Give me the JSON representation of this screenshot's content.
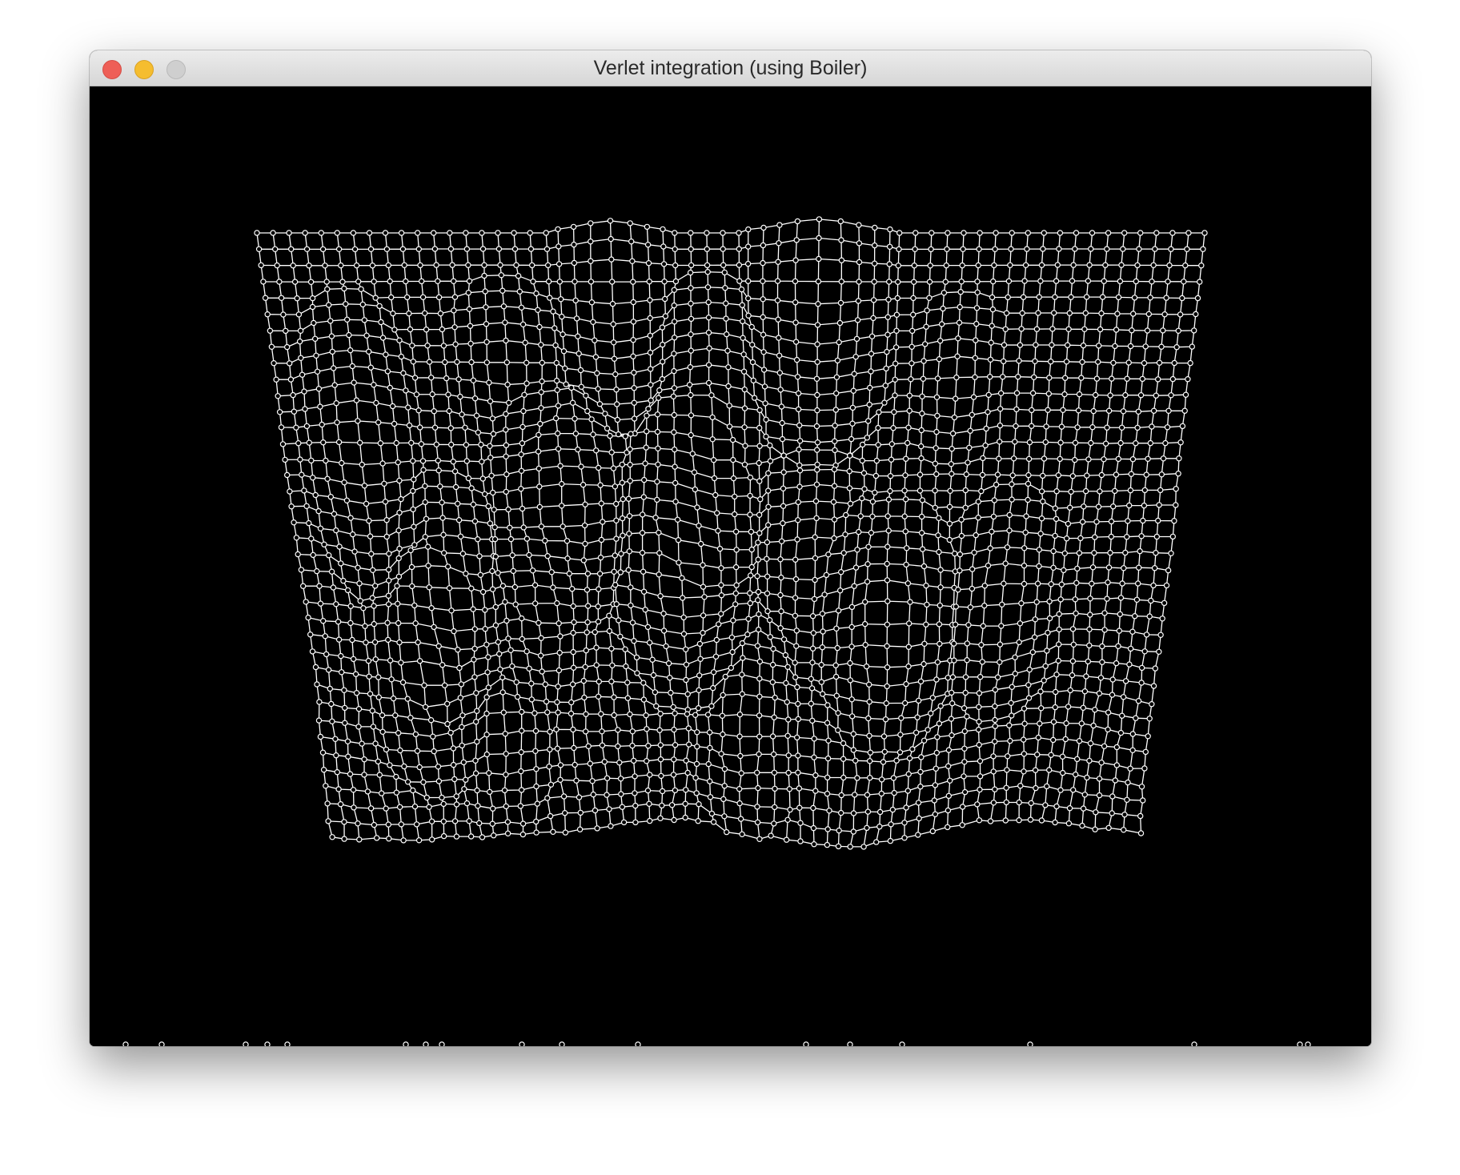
{
  "window": {
    "title": "Verlet integration (using Boiler)"
  },
  "controls": {
    "close": "close-button",
    "minimize": "minimize-button",
    "zoom": "zoom-button"
  },
  "colors": {
    "canvas_background": "#000000",
    "cloth_mesh": "#ffffff"
  },
  "scene": {
    "type": "verlet cloth simulation",
    "pinned": "top row"
  }
}
